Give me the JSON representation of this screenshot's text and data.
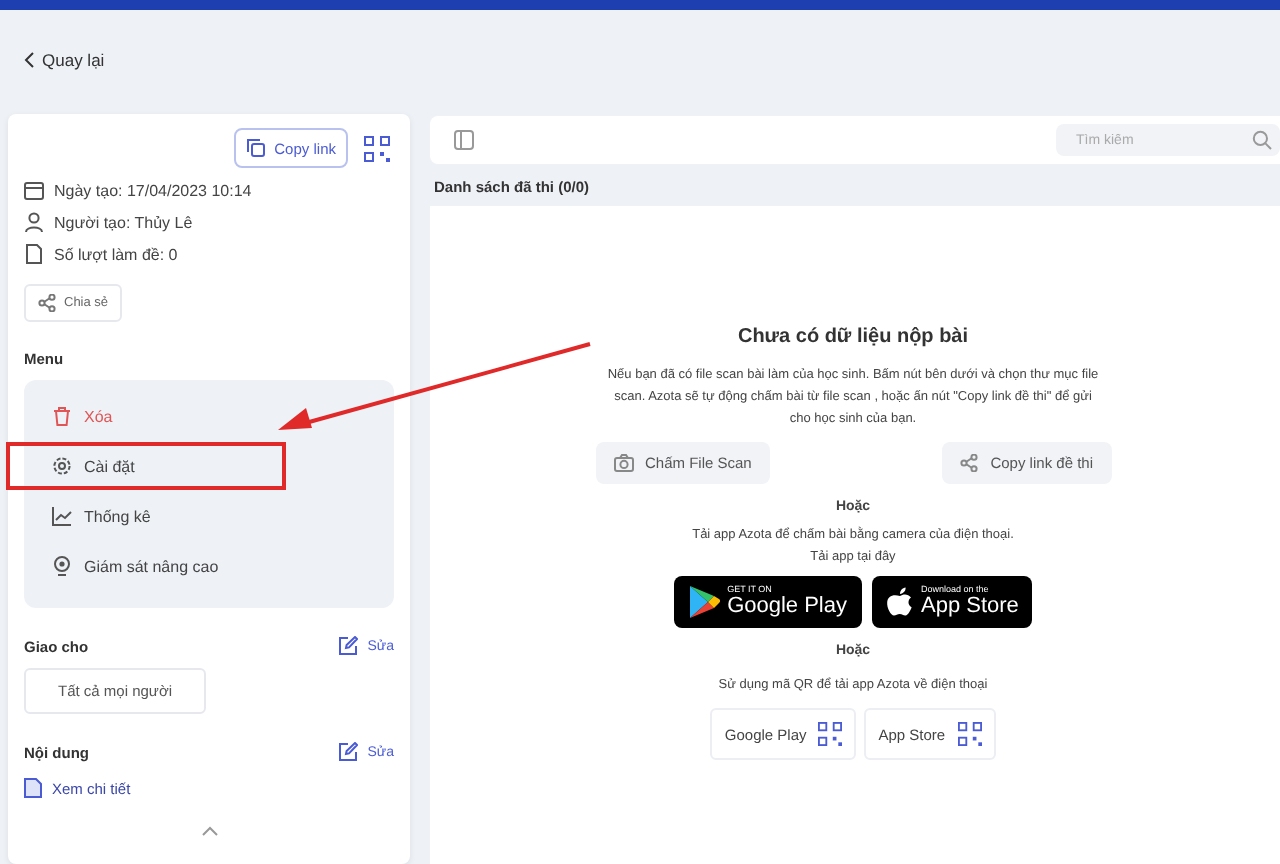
{
  "back_link": "Quay lại",
  "exam": {
    "copy_button": "Copy link",
    "date": "Ngày tạo: 17/04/2023 10:14",
    "creator": "Người tạo: Thủy Lê",
    "attempts": "Số lượt làm đề: 0",
    "share_button": "Chia sẻ"
  },
  "menu": {
    "title": "Menu",
    "items": [
      {
        "kind": "delete",
        "label": "Xóa",
        "highlighted": false
      },
      {
        "kind": "settings",
        "label": "Cài đặt",
        "highlighted": true
      },
      {
        "kind": "stats",
        "label": "Thống kê",
        "highlighted": false
      },
      {
        "kind": "monitor",
        "label": "Giám sát nâng cao",
        "highlighted": false
      }
    ]
  },
  "assign": {
    "title": "Giao cho",
    "edit": "Sửa",
    "value": "Tất cả mọi người"
  },
  "content": {
    "title": "Nội dung",
    "edit": "Sửa",
    "link": "Xem chi tiết"
  },
  "search": {
    "placeholder": "Tìm kiếm"
  },
  "list_title": "Danh sách đã thi (0/0)",
  "empty": {
    "title": "Chưa có dữ liệu nộp bài",
    "text": "Nếu bạn đã có file scan bài làm của học sinh. Bấm nút bên dưới và chọn thư mục file scan. Azota sẽ tự động chấm bài từ file scan , hoặc ấn nút \"Copy link đề thi\" để gửi cho học sinh của bạn.",
    "buttons": [
      {
        "kind": "camera",
        "label": "Chấm File Scan"
      },
      {
        "kind": "share",
        "label": "Copy link đề thi"
      }
    ],
    "or_1": "Hoặc",
    "app_text": "Tải app Azota để chấm bài bằng camera của điện thoại. Tải app tại đây",
    "stores": [
      {
        "kind": "google",
        "small": "GET IT ON",
        "big": "Google Play"
      },
      {
        "kind": "apple",
        "small": "Download on the",
        "big": "App Store"
      }
    ],
    "or_2": "Hoặc",
    "qr_text": "Sử dụng mã QR để tải app Azota về điện thoại",
    "qr_buttons": [
      "Google Play",
      "App Store"
    ]
  }
}
